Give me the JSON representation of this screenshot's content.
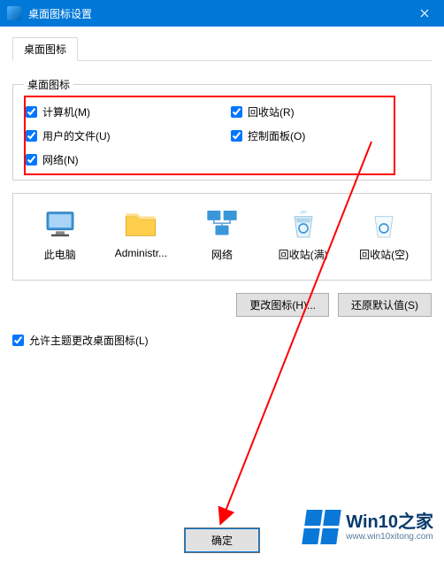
{
  "window": {
    "title": "桌面图标设置",
    "tab_label": "桌面图标",
    "group_legend": "桌面图标"
  },
  "checks": {
    "computer": "计算机(M)",
    "recycle": "回收站(R)",
    "userfiles": "用户的文件(U)",
    "controlpanel": "控制面板(O)",
    "network": "网络(N)"
  },
  "icons": {
    "thispc": "此电脑",
    "admin": "Administr...",
    "network": "网络",
    "recycle_full": "回收站(满)",
    "recycle_empty": "回收站(空)"
  },
  "buttons": {
    "change_icon": "更改图标(H)...",
    "restore_default": "还原默认值(S)",
    "ok": "确定"
  },
  "allow_theme": "允许主题更改桌面图标(L)",
  "brand": {
    "name": "Win10之家",
    "url": "www.win10xitong.com"
  }
}
